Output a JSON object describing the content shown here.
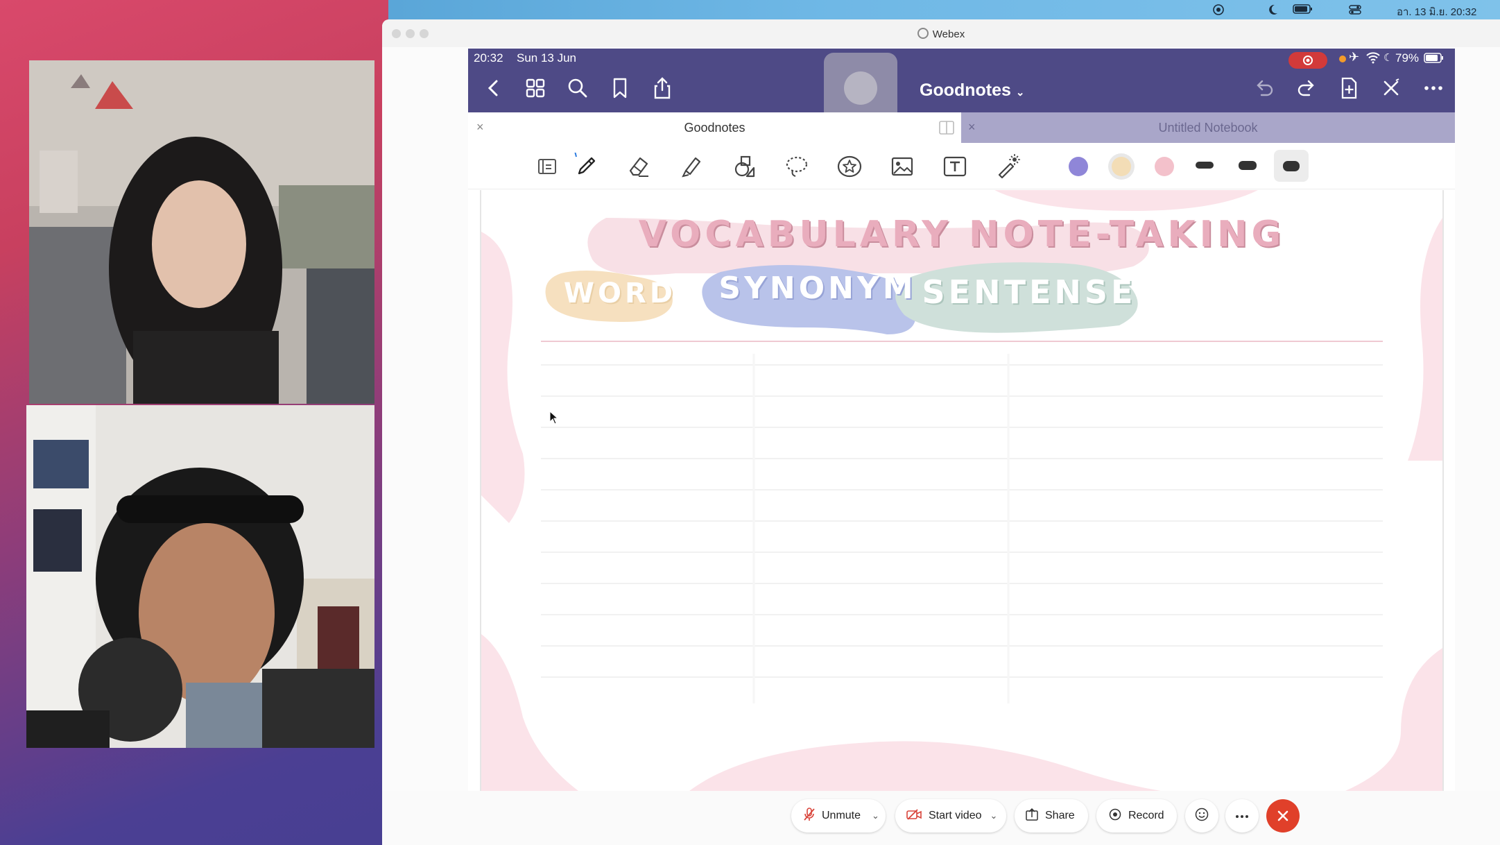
{
  "menubar": {
    "datetime": "อา. 13 มิ.ย. 20:32"
  },
  "window": {
    "title": "Webex"
  },
  "ipad": {
    "status_time": "20:32",
    "status_date": "Sun 13 Jun",
    "battery": "79%",
    "notebook_title": "Goodnotes",
    "tab_active": "Goodnotes",
    "tab_inactive": "Untitled Notebook"
  },
  "page": {
    "title": "VOCABULARY NOTE-TAKING",
    "col_word": "WORD",
    "col_synonym": "SYNONYM",
    "col_sentence": "SENTENSE"
  },
  "colors": {
    "ipad_bar": "#4e4a86",
    "pen_purple": "#8f86d8",
    "pen_cream": "#f3ddb6",
    "pen_pink": "#f3c1cb",
    "word_bg": "#f6e0bf",
    "synonym_bg": "#b9c3ea",
    "sentence_bg": "#cfe0da",
    "title_bg": "#f6d5de",
    "leave": "#e0402a"
  },
  "controls": {
    "unmute": "Unmute",
    "start_video": "Start video",
    "share": "Share",
    "record": "Record"
  }
}
